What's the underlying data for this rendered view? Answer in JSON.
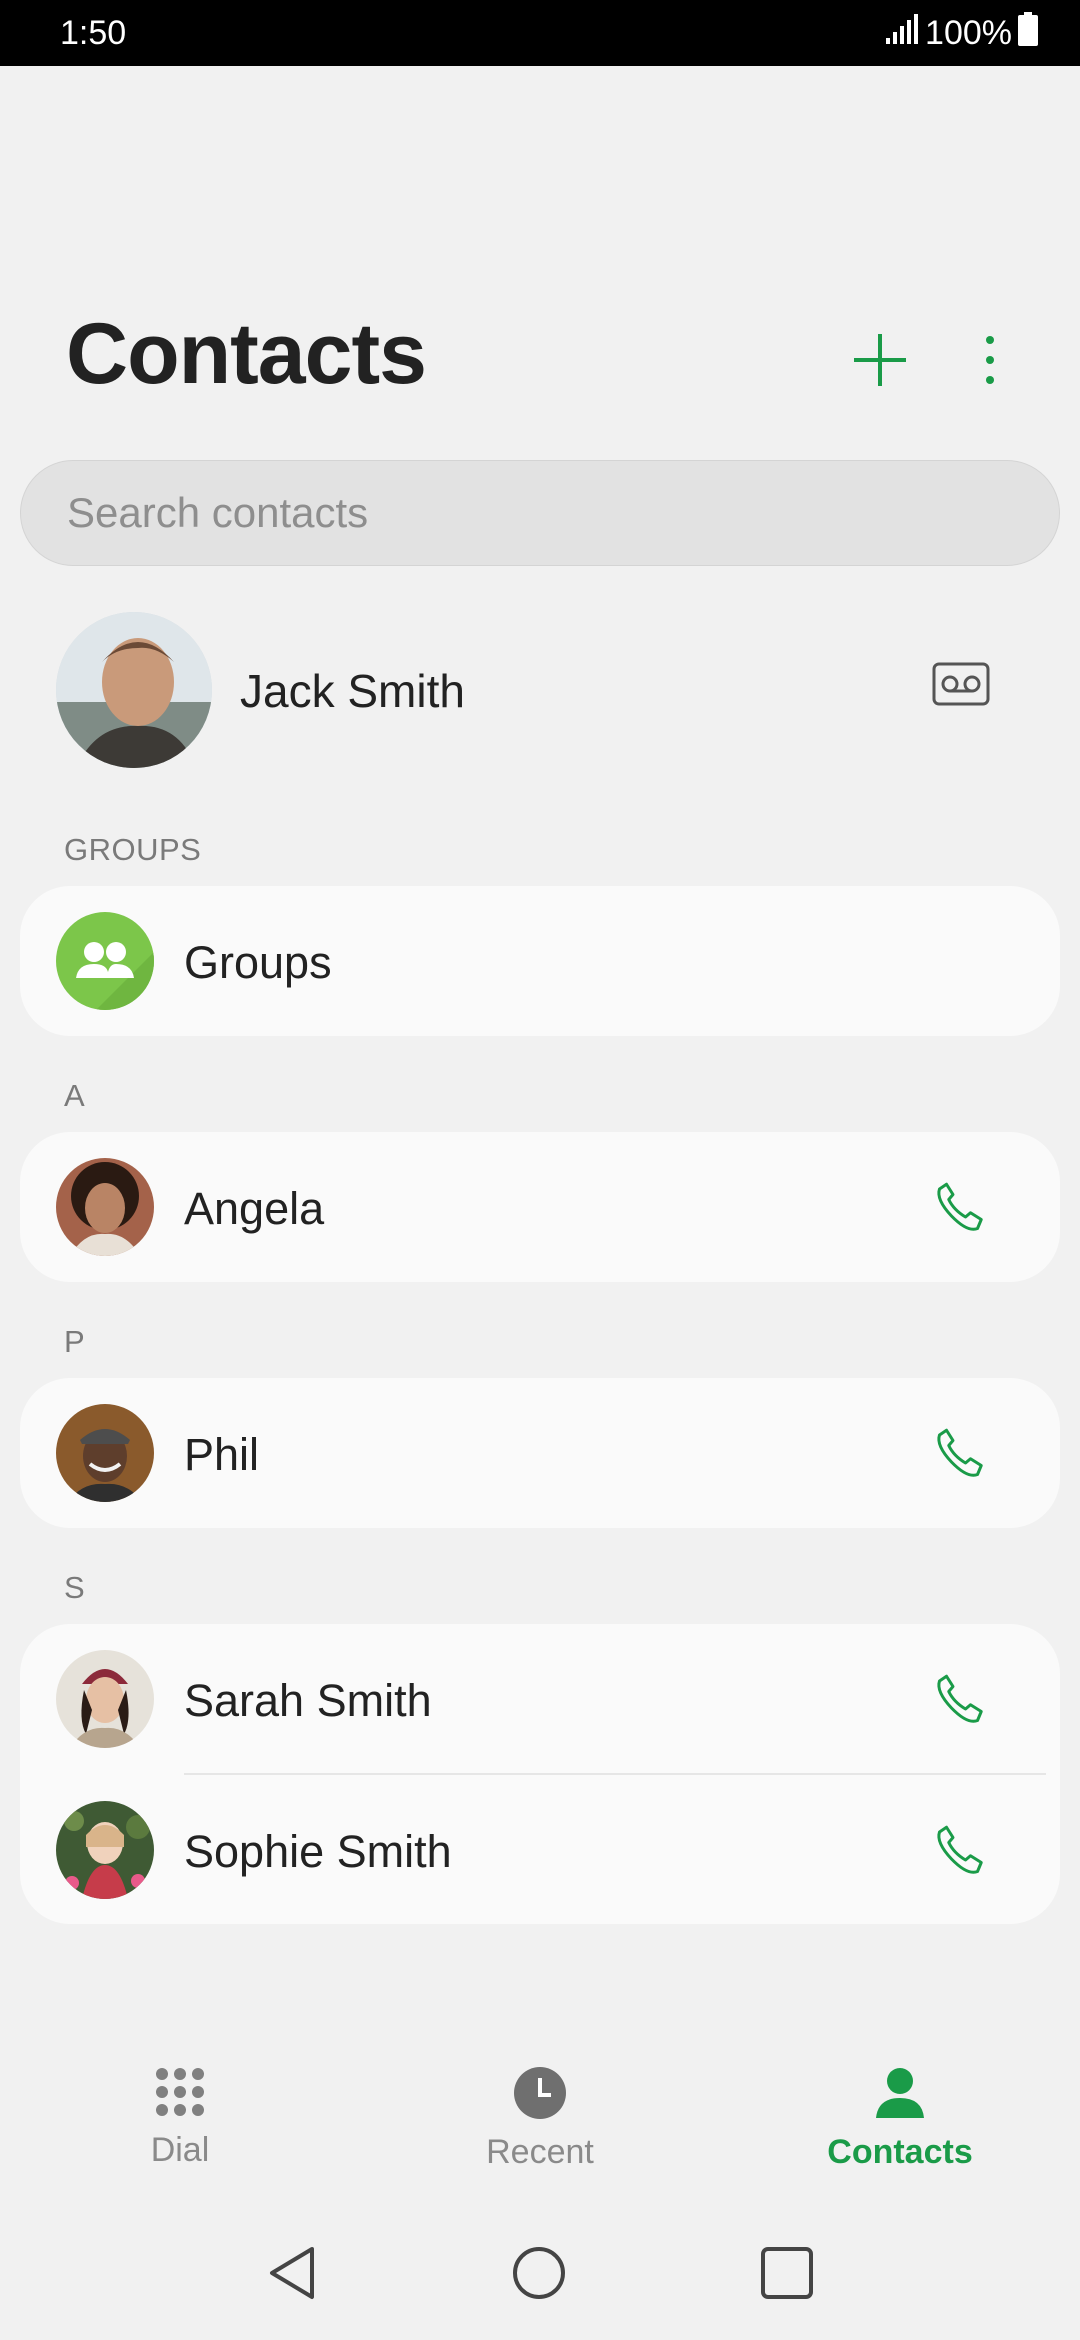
{
  "status": {
    "time": "1:50",
    "battery": "100%"
  },
  "header": {
    "title": "Contacts",
    "add_icon": "plus-icon",
    "more_icon": "more-vert-icon"
  },
  "search": {
    "placeholder": "Search contacts"
  },
  "profile": {
    "name": "Jack Smith",
    "voicemail_icon": "voicemail-icon"
  },
  "groups_section": {
    "label": "GROUPS",
    "item_label": "Groups"
  },
  "sections": [
    {
      "letter": "A",
      "contacts": [
        {
          "name": "Angela"
        }
      ]
    },
    {
      "letter": "P",
      "contacts": [
        {
          "name": "Phil"
        }
      ]
    },
    {
      "letter": "S",
      "contacts": [
        {
          "name": "Sarah Smith"
        },
        {
          "name": "Sophie Smith"
        }
      ]
    }
  ],
  "bottom_nav": {
    "items": [
      {
        "label": "Dial",
        "icon": "dialpad-icon",
        "active": false
      },
      {
        "label": "Recent",
        "icon": "clock-icon",
        "active": false
      },
      {
        "label": "Contacts",
        "icon": "person-icon",
        "active": true
      }
    ]
  },
  "colors": {
    "accent": "#1a9b48",
    "groups_icon_bg": "#7cc64a"
  }
}
